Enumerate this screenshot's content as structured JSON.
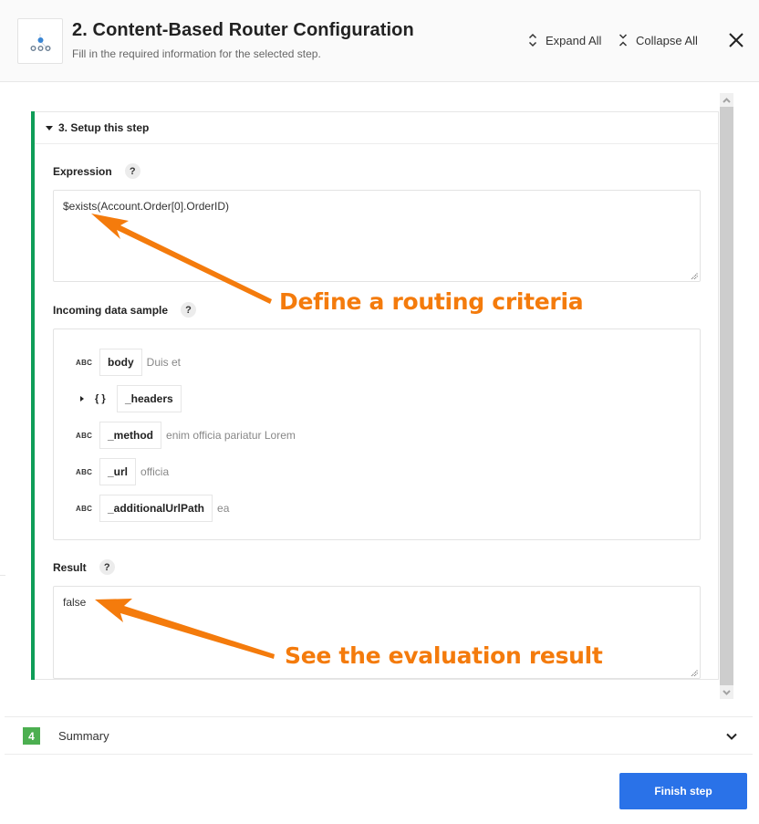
{
  "header": {
    "title": "2. Content-Based Router Configuration",
    "subtitle": "Fill in the required information for the selected step.",
    "expand_all_label": "Expand All",
    "collapse_all_label": "Collapse All",
    "logo_icon": "router-icon",
    "close_icon": "close-icon"
  },
  "section": {
    "title": "3. Setup this step",
    "expression": {
      "label": "Expression",
      "help": "?",
      "value": "$exists(Account.Order[0].OrderID)"
    },
    "incoming": {
      "label": "Incoming data sample",
      "help": "?",
      "items": [
        {
          "type": "ABC",
          "key": "body",
          "value": "Duis et"
        },
        {
          "type": "{ }",
          "key": "_headers",
          "value": "",
          "expandable": true
        },
        {
          "type": "ABC",
          "key": "_method",
          "value": "enim officia pariatur Lorem"
        },
        {
          "type": "ABC",
          "key": "_url",
          "value": "officia"
        },
        {
          "type": "ABC",
          "key": "_additionalUrlPath",
          "value": "ea"
        }
      ]
    },
    "result": {
      "label": "Result",
      "help": "?",
      "value": "false"
    }
  },
  "annotations": {
    "routing": "Define a routing criteria",
    "result": "See the evaluation result",
    "color": "#f47b0c"
  },
  "summary": {
    "step_number": "4",
    "label": "Summary"
  },
  "footer": {
    "finish_label": "Finish step"
  },
  "colors": {
    "accent_green": "#0f9d58",
    "step_badge_green": "#4caf50",
    "primary_button": "#2a72e8"
  }
}
